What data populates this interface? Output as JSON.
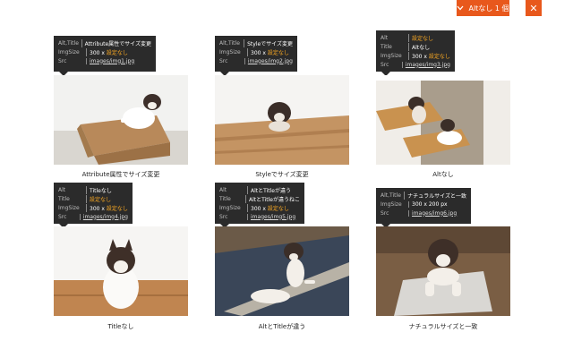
{
  "toolbar": {
    "alt_button_label": "Altなし 1 個",
    "close_symbol": "✕"
  },
  "cards": [
    {
      "alt_title_key": "Alt,Title",
      "alt_title_value": "Attribute属性でサイズ変更",
      "imgsize_key": "ImgSize",
      "imgsize_w": "300",
      "imgsize_x": "x",
      "imgsize_h": "設定なし",
      "src_key": "Src",
      "src_value": "images/img1.jpg",
      "caption": "Attribute属性でサイズ変更"
    },
    {
      "alt_title_key": "Alt,Title",
      "alt_title_value": "Styleでサイズ変更",
      "imgsize_key": "ImgSize",
      "imgsize_w": "300",
      "imgsize_x": "x",
      "imgsize_h": "設定なし",
      "src_key": "Src",
      "src_value": "images/img2.jpg",
      "caption": "Styleでサイズ変更"
    },
    {
      "alt_key": "Alt",
      "alt_value": "設定なし",
      "title_key": "Title",
      "title_value": "Altなし",
      "imgsize_key": "ImgSize",
      "imgsize_w": "300",
      "imgsize_x": "x",
      "imgsize_h": "設定なし",
      "src_key": "Src",
      "src_value": "images/img3.jpg",
      "caption": "Altなし"
    },
    {
      "alt_key": "Alt",
      "alt_value": "Titleなし",
      "title_key": "Title",
      "title_value": "設定なし",
      "imgsize_key": "ImgSize",
      "imgsize_w": "300",
      "imgsize_x": "x",
      "imgsize_h": "設定なし",
      "src_key": "Src",
      "src_value": "images/img4.jpg",
      "caption": "Titleなし"
    },
    {
      "alt_key": "Alt",
      "alt_value": "AltとTitleが違う",
      "title_key": "Title",
      "title_value": "AltとTitleが違うねこ",
      "imgsize_key": "ImgSize",
      "imgsize_w": "300",
      "imgsize_x": "x",
      "imgsize_h": "設定なし",
      "src_key": "Src",
      "src_value": "images/img5.jpg",
      "caption": "AltとTitleが違う"
    },
    {
      "alt_title_key": "Alt,Title",
      "alt_title_value": "ナチュラルサイズと一致",
      "imgsize_key": "ImgSize",
      "imgsize_w": "300",
      "imgsize_x": "x",
      "imgsize_h": "200 px",
      "src_key": "Src",
      "src_value": "images/img6.jpg",
      "caption": "ナチュラルサイズと一致"
    }
  ]
}
